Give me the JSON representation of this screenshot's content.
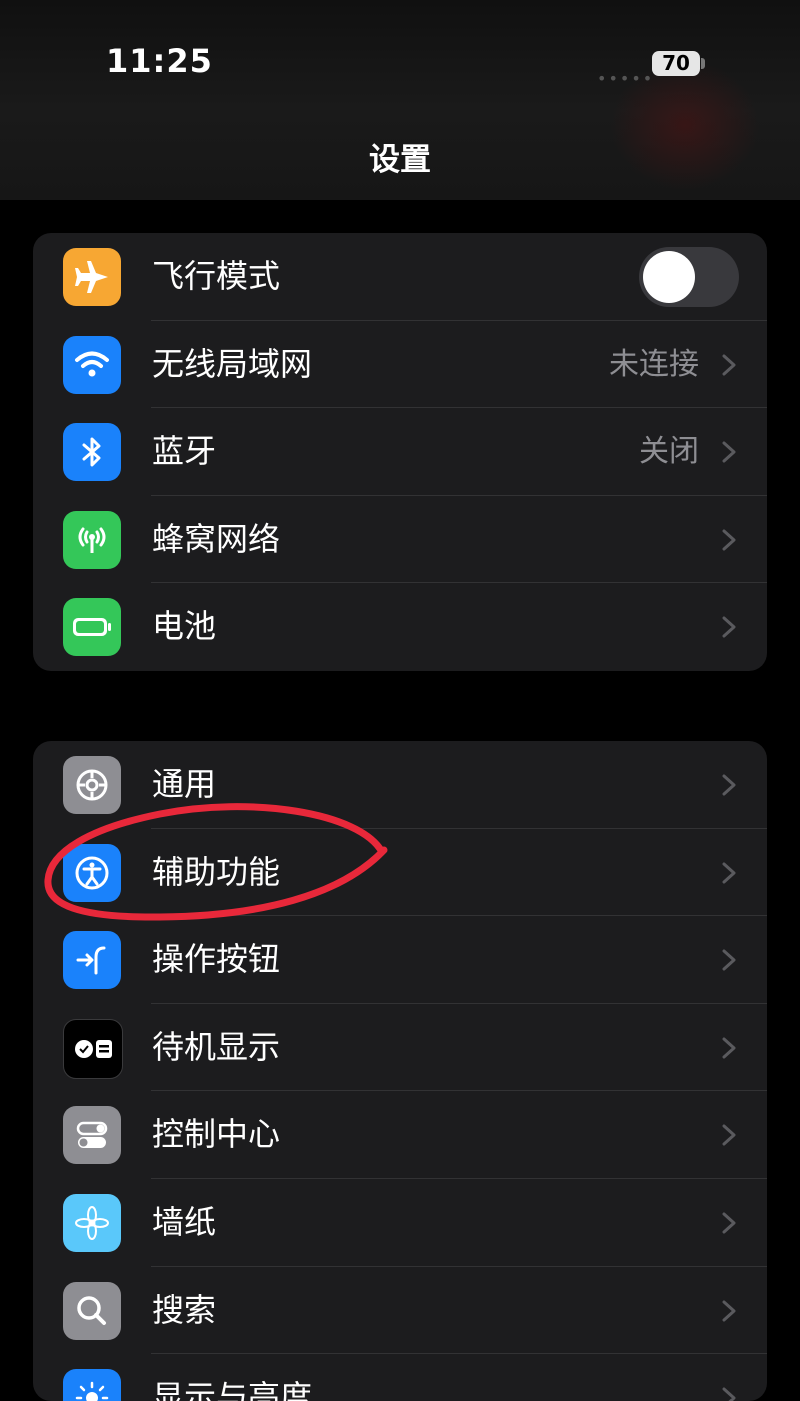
{
  "status_bar": {
    "time": "11:25",
    "signal": "•••••",
    "battery": "70"
  },
  "nav": {
    "title": "设置"
  },
  "groups": [
    {
      "items": [
        {
          "label": "飞行模式",
          "icon": "airplane-icon",
          "color": "#f7a733",
          "toggle": true
        },
        {
          "label": "无线局域网",
          "icon": "wifi-icon",
          "color": "#1a82fb",
          "value": "未连接"
        },
        {
          "label": "蓝牙",
          "icon": "bluetooth-icon",
          "color": "#1a82fb",
          "value": "关闭"
        },
        {
          "label": "蜂窝网络",
          "icon": "cellular-icon",
          "color": "#34c759"
        },
        {
          "label": "电池",
          "icon": "battery-icon",
          "color": "#34c759"
        }
      ]
    },
    {
      "items": [
        {
          "label": "通用",
          "icon": "gear-icon",
          "color": "#8e8e93"
        },
        {
          "label": "辅助功能",
          "icon": "accessibility-icon",
          "color": "#1a82fb"
        },
        {
          "label": "操作按钮",
          "icon": "action-button-icon",
          "color": "#1a82fb"
        },
        {
          "label": "待机显示",
          "icon": "standby-icon",
          "color": "#000000"
        },
        {
          "label": "控制中心",
          "icon": "control-center-icon",
          "color": "#8e8e93"
        },
        {
          "label": "墙纸",
          "icon": "wallpaper-icon",
          "color": "#5ac8fa"
        },
        {
          "label": "搜索",
          "icon": "search-icon",
          "color": "#8e8e93"
        },
        {
          "label": "显示与亮度",
          "icon": "brightness-icon",
          "color": "#1a82fb"
        }
      ]
    }
  ]
}
